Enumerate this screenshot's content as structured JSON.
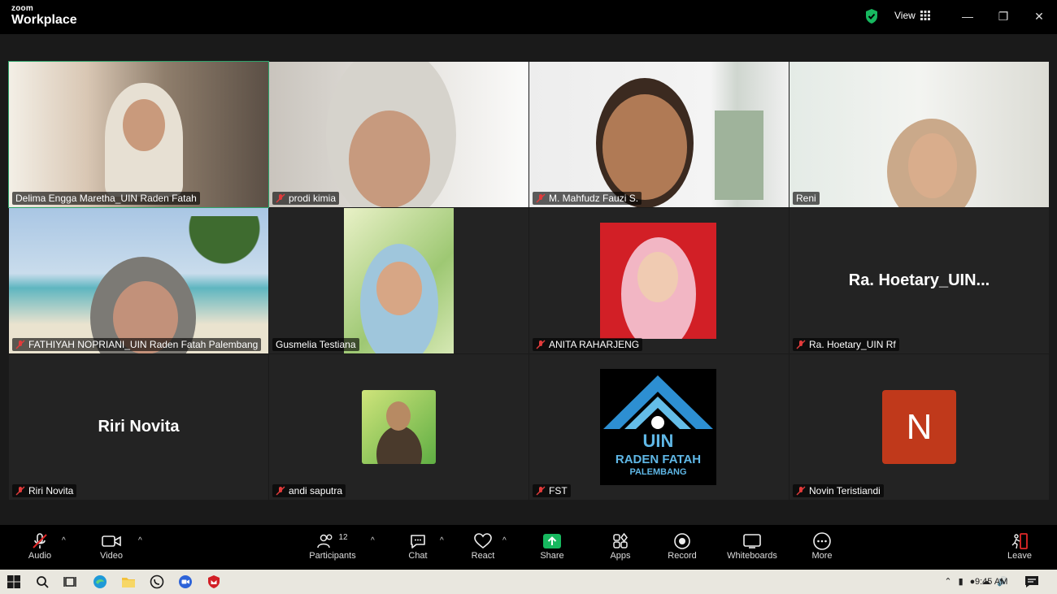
{
  "title_bar": {
    "brand_small": "zoom",
    "brand_large": "Workplace",
    "view_label": "View"
  },
  "participants": [
    {
      "name": "Delima Engga Maretha_UIN Raden Fatah",
      "muted": false,
      "active": true
    },
    {
      "name": "prodi kimia",
      "muted": true
    },
    {
      "name": "M. Mahfudz Fauzi S.",
      "muted": true
    },
    {
      "name": "Reni",
      "muted": false
    },
    {
      "name": "FATHIYAH NOPRIANI_UIN Raden Fatah Palembang",
      "muted": true
    },
    {
      "name": "Gusmelia Testiana",
      "muted": false
    },
    {
      "name": "ANITA RAHARJENG",
      "muted": true
    },
    {
      "name": "Ra. Hoetary_UIN Rf",
      "muted": true,
      "display_name": "Ra.  Hoetary_UIN..."
    },
    {
      "name": "Riri Novita",
      "muted": true,
      "display_name": "Riri Novita"
    },
    {
      "name": "andi saputra",
      "muted": true
    },
    {
      "name": "FST",
      "muted": true,
      "logo_text_1": "UIN",
      "logo_text_2": "RADEN FATAH",
      "logo_text_3": "PALEMBANG"
    },
    {
      "name": "Novin Teristiandi",
      "muted": true,
      "avatar_letter": "N"
    }
  ],
  "toolbar": {
    "audio": "Audio",
    "video": "Video",
    "participants": "Participants",
    "participants_count": "12",
    "chat": "Chat",
    "react": "React",
    "share": "Share",
    "apps": "Apps",
    "record": "Record",
    "whiteboards": "Whiteboards",
    "more": "More",
    "leave": "Leave"
  },
  "taskbar": {
    "time": "9:45 AM"
  },
  "colors": {
    "active_border": "#2ea36b",
    "share_green": "#17b85f",
    "leave_red": "#e02828",
    "avatar_N": "#c0391b",
    "mute_red": "#e23b3b"
  }
}
